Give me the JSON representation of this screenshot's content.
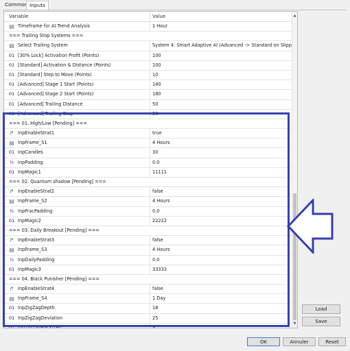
{
  "tabs": {
    "common": "Common",
    "inputs": "Inputs"
  },
  "table": {
    "header_variable": "Variable",
    "header_value": "Value",
    "rows": [
      {
        "icon": "enum",
        "glyph": "▤",
        "variable": "Timeframe for AI Trend Analysis",
        "value": "1 Hour"
      },
      {
        "icon": "section",
        "glyph": "",
        "variable": "=== Trailing Stop Systems ===",
        "value": ""
      },
      {
        "icon": "enum",
        "glyph": "▤",
        "variable": "Select Trailing System",
        "value": "System 4: Smart Adaptive AI (Advanced -> Standard on Slippage)"
      },
      {
        "icon": "int",
        "glyph": "01",
        "variable": "[30% Lock] Activation Profit (Points)",
        "value": "100"
      },
      {
        "icon": "int",
        "glyph": "01",
        "variable": "[Standard] Activation & Distance (Points)",
        "value": "100"
      },
      {
        "icon": "int",
        "glyph": "01",
        "variable": "[Standard] Step to Move (Points)",
        "value": "10"
      },
      {
        "icon": "int",
        "glyph": "01",
        "variable": "[Advanced] Stage 1 Start (Points)",
        "value": "140"
      },
      {
        "icon": "int",
        "glyph": "01",
        "variable": "[Advanced] Stage 2 Start (Points)",
        "value": "180"
      },
      {
        "icon": "int",
        "glyph": "01",
        "variable": "[Advanced] Trailing Distance",
        "value": "50"
      },
      {
        "icon": "int",
        "glyph": "01",
        "variable": "[Advanced] Trailing Step",
        "value": "50"
      },
      {
        "icon": "section",
        "glyph": "",
        "variable": "=== 01. High/Low [Pending] ===",
        "value": ""
      },
      {
        "icon": "flag",
        "glyph": "↱",
        "variable": "InpEnableStrat1",
        "value": "true"
      },
      {
        "icon": "enum",
        "glyph": "▤",
        "variable": "InpFrame_S1",
        "value": "4 Hours"
      },
      {
        "icon": "int",
        "glyph": "01",
        "variable": "InpCandles",
        "value": "30"
      },
      {
        "icon": "dbl",
        "glyph": "½",
        "variable": "InpPadding",
        "value": "0.0"
      },
      {
        "icon": "int",
        "glyph": "01",
        "variable": "InpMagic1",
        "value": "11111"
      },
      {
        "icon": "section",
        "glyph": "",
        "variable": "=== 02. Quantum shadow [Pending] ===",
        "value": ""
      },
      {
        "icon": "flag",
        "glyph": "↱",
        "variable": "InpEnableStrat2",
        "value": "false"
      },
      {
        "icon": "enum",
        "glyph": "▤",
        "variable": "InpFrame_S2",
        "value": "4 Hours"
      },
      {
        "icon": "dbl",
        "glyph": "½",
        "variable": "InpFracPadding",
        "value": "0.0"
      },
      {
        "icon": "int",
        "glyph": "01",
        "variable": "InpMagic2",
        "value": "22222"
      },
      {
        "icon": "section",
        "glyph": "",
        "variable": "=== 03. Daily Breakout [Pending] ===",
        "value": ""
      },
      {
        "icon": "flag",
        "glyph": "↱",
        "variable": "InpEnableStrat3",
        "value": "false"
      },
      {
        "icon": "enum",
        "glyph": "▤",
        "variable": "InpFrame_S3",
        "value": "4 Hours"
      },
      {
        "icon": "dbl",
        "glyph": "½",
        "variable": "InpDailyPadding",
        "value": "0.0"
      },
      {
        "icon": "int",
        "glyph": "01",
        "variable": "InpMagic3",
        "value": "33333"
      },
      {
        "icon": "section",
        "glyph": "",
        "variable": "=== 04. Black Punisher [Pending] ===",
        "value": ""
      },
      {
        "icon": "flag",
        "glyph": "↱",
        "variable": "InpEnableStrat4",
        "value": "false"
      },
      {
        "icon": "enum",
        "glyph": "▤",
        "variable": "InpFrame_S4",
        "value": "1 Day"
      },
      {
        "icon": "int",
        "glyph": "01",
        "variable": "InpZigZagDepth",
        "value": "18"
      },
      {
        "icon": "int",
        "glyph": "01",
        "variable": "InpZigZagDeviation",
        "value": "25"
      },
      {
        "icon": "int",
        "glyph": "01",
        "variable": "InpZigZagBackstep",
        "value": "3"
      },
      {
        "icon": "int",
        "glyph": "01",
        "variable": "InpZigZagCandleWait",
        "value": "15"
      },
      {
        "icon": "int",
        "glyph": "01",
        "variable": "InpMagic4",
        "value": "44444"
      }
    ]
  },
  "side_buttons": {
    "load": "Load",
    "save": "Save"
  },
  "footer_buttons": {
    "ok": "OK",
    "annuler": "Annuler",
    "reset": "Reset"
  },
  "colors": {
    "highlight": "#3440b0",
    "flag_icon": "#2c8a2c",
    "enum_icon": "#5570a0"
  }
}
